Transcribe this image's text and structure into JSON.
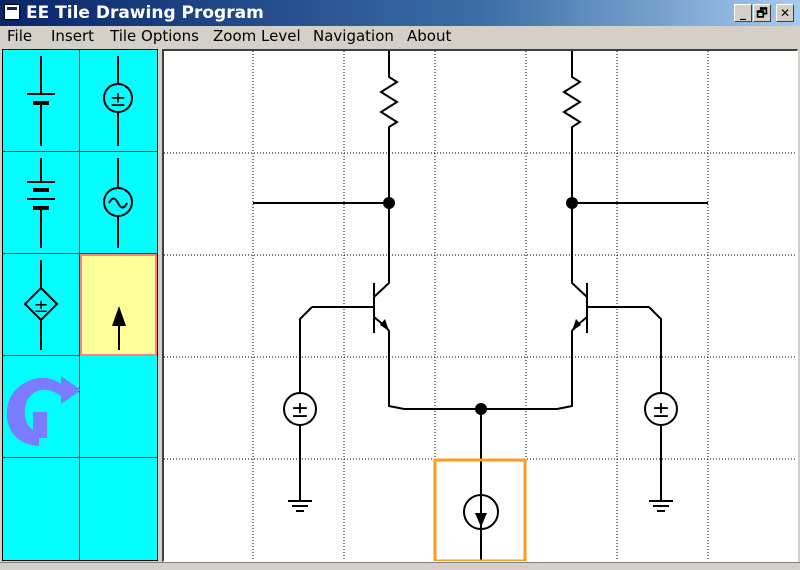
{
  "window": {
    "title": "EE Tile Drawing Program",
    "buttons": {
      "minimize": "_",
      "restore": "🗗",
      "close": "✕"
    }
  },
  "menu": [
    "File",
    "Insert",
    "Tile Options",
    "Zoom Level",
    "Navigation",
    "About"
  ],
  "palette": {
    "tiles": [
      {
        "name": "battery-single-icon",
        "sign": ""
      },
      {
        "name": "dc-voltage-source-icon",
        "sign": "±"
      },
      {
        "name": "battery-multi-cell-icon",
        "sign": ""
      },
      {
        "name": "ac-voltage-source-icon",
        "sign": "~"
      },
      {
        "name": "dependent-voltage-source-icon",
        "sign": "±"
      },
      {
        "name": "current-source-up-icon",
        "sign": ""
      },
      {
        "name": "rotate-arrow-icon",
        "sign": ""
      },
      {
        "name": "empty-tile",
        "sign": ""
      },
      {
        "name": "empty-tile",
        "sign": ""
      },
      {
        "name": "empty-tile",
        "sign": ""
      }
    ],
    "selected_index": 5,
    "colors": {
      "background": "#00ffff",
      "grid": "#2020c0",
      "selected_fill": "#ffff99",
      "selected_border": "#ff8080",
      "rotate_arrow": "#7b7bff"
    }
  },
  "canvas": {
    "columns": 7,
    "rows": 5,
    "grid_color": "#000000",
    "selection_color": "#ff9922",
    "selected_cell": {
      "col": 3,
      "row": 4
    },
    "source_sign_left": "±",
    "source_sign_right": "±"
  }
}
